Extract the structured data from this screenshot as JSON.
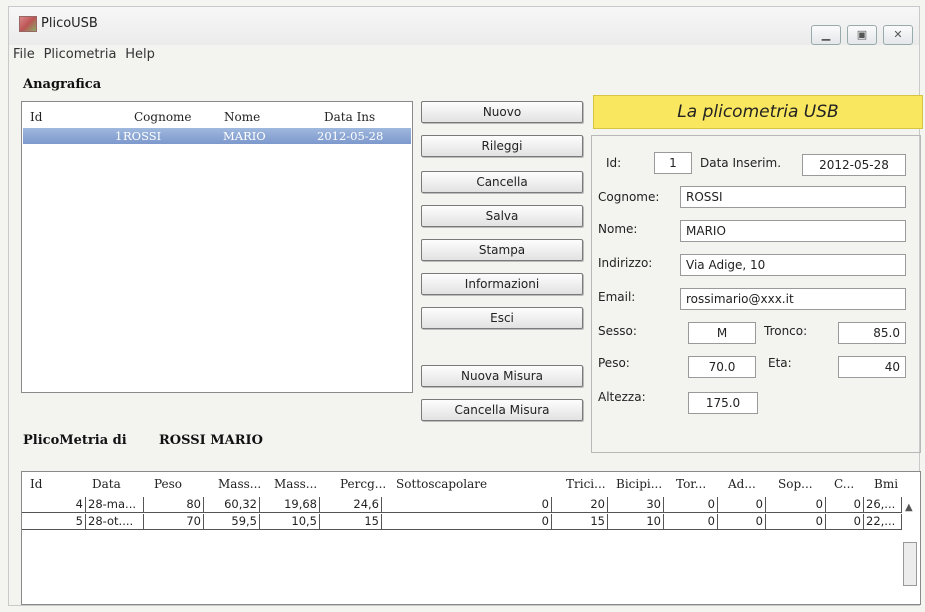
{
  "window": {
    "title": "PlicoUSB"
  },
  "menu": [
    "File",
    "Plicometria",
    "Help"
  ],
  "anagrafica": {
    "title": "Anagrafica",
    "columns": [
      "Id",
      "Cognome",
      "Nome",
      "Data Ins"
    ],
    "rows": [
      {
        "id": "1",
        "cognome": "ROSSI",
        "nome": "MARIO",
        "data": "2012-05-28"
      }
    ]
  },
  "buttons": {
    "nuovo": "Nuovo",
    "rileggi": "Rileggi",
    "cancella": "Cancella",
    "salva": "Salva",
    "stampa": "Stampa",
    "informazioni": "Informazioni",
    "esci": "Esci",
    "nuova_misura": "Nuova Misura",
    "cancella_misura": "Cancella Misura"
  },
  "banner": "La plicometria USB",
  "form": {
    "id_label": "Id:",
    "id_value": "1",
    "data_label": "Data Inserim.",
    "data_value": "2012-05-28",
    "cognome_label": "Cognome:",
    "cognome_value": "ROSSI",
    "nome_label": "Nome:",
    "nome_value": "MARIO",
    "indirizzo_label": "Indirizzo:",
    "indirizzo_value": "Via Adige, 10",
    "email_label": "Email:",
    "email_value": "rossimario@xxx.it",
    "sesso_label": "Sesso:",
    "sesso_value": "M",
    "tronco_label": "Tronco:",
    "tronco_value": "85.0",
    "peso_label": "Peso:",
    "peso_value": "70.0",
    "eta_label": "Eta:",
    "eta_value": "40",
    "altezza_label": "Altezza:",
    "altezza_value": "175.0"
  },
  "misure": {
    "title_prefix": "PlicoMetria di",
    "title_name": "ROSSI MARIO",
    "columns": [
      "Id",
      "Data",
      "Peso",
      "Mass...",
      "Mass...",
      "Percg...",
      "Sottoscapolare",
      "Trici...",
      "Bicipi...",
      "Tor...",
      "Ad...",
      "Sop...",
      "C...",
      "Bmi"
    ],
    "rows": [
      [
        "4",
        "28-ma...",
        "80",
        "60,32",
        "19,68",
        "24,6",
        "0",
        "20",
        "30",
        "0",
        "0",
        "0",
        "0",
        "26,..."
      ],
      [
        "5",
        "28-ot....",
        "70",
        "59,5",
        "10,5",
        "15",
        "0",
        "15",
        "10",
        "0",
        "0",
        "0",
        "0",
        "22,..."
      ]
    ]
  },
  "icons": {
    "app": "app-icon",
    "minimize": "minimize-icon",
    "maximize": "maximize-icon",
    "close": "close-icon"
  }
}
